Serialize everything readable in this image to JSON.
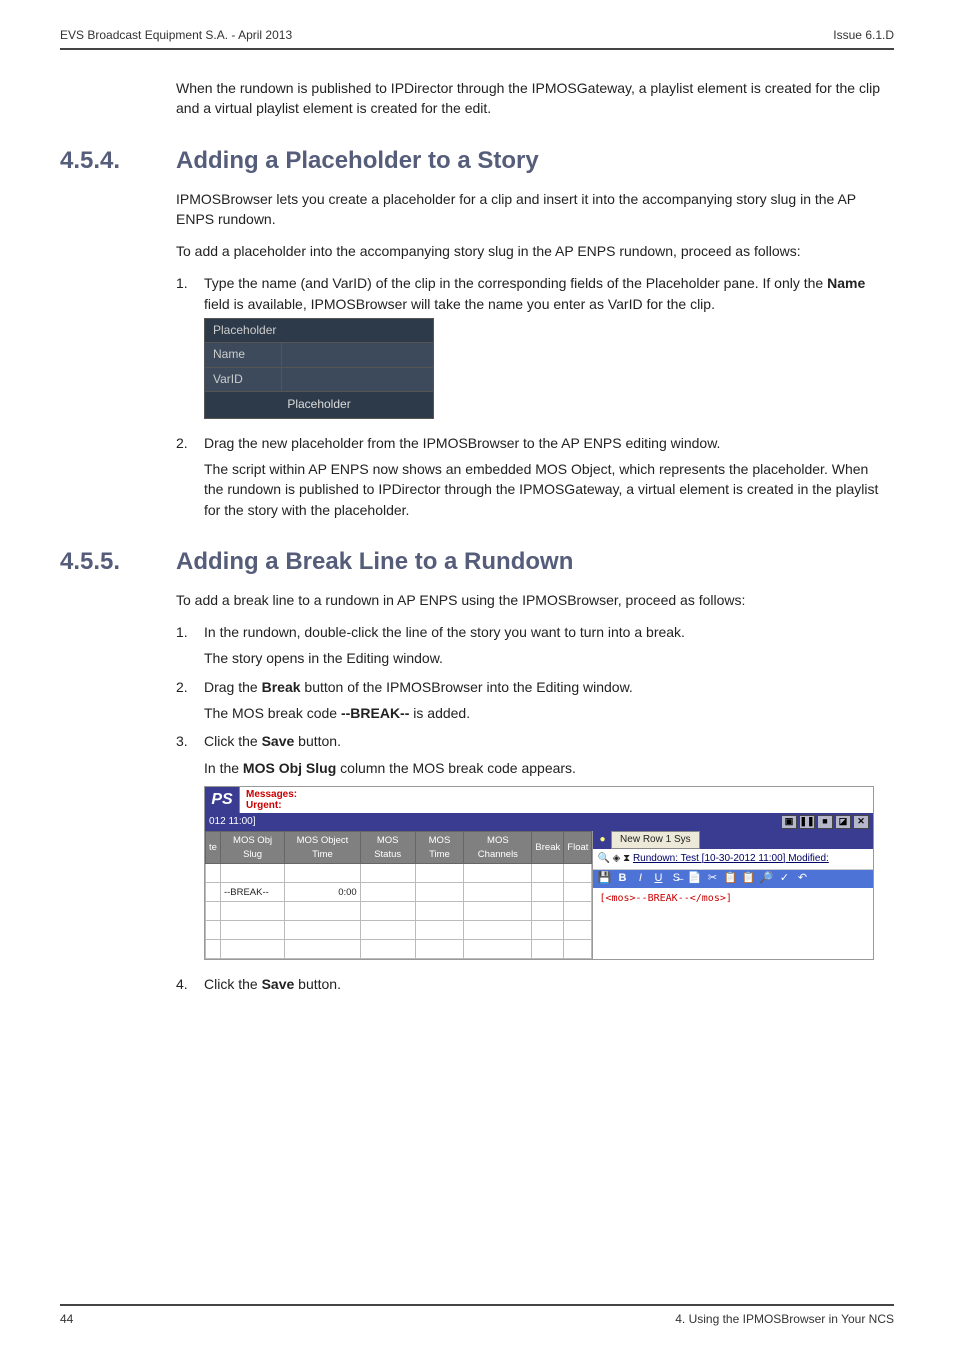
{
  "header": {
    "left": "EVS Broadcast Equipment S.A. - April 2013",
    "right": "Issue 6.1.D"
  },
  "intro": "When the rundown is published to IPDirector through the IPMOSGateway, a playlist element is created for the clip and a virtual playlist element is created for the edit.",
  "section454": {
    "num": "4.5.4.",
    "title": "Adding a Placeholder to a Story",
    "p1": "IPMOSBrowser lets you create a placeholder for a clip and insert it into the accompanying story slug in the AP ENPS rundown.",
    "p2": "To add a placeholder into the accompanying story slug in the AP ENPS rundown, proceed as follows:",
    "step1_a": "Type the name (and VarID) of the clip in the corresponding fields of the Placeholder pane. If only the ",
    "step1_b": "Name",
    "step1_c": " field is available, IPMOSBrowser will take the name you enter as VarID for the clip.",
    "ph": {
      "hdr": "Placeholder",
      "name": "Name",
      "varid": "VarID",
      "btn": "Placeholder"
    },
    "step2": "Drag the new placeholder from the IPMOSBrowser to the AP ENPS editing window.",
    "step2_p": "The script within AP ENPS now shows an embedded MOS Object, which represents the placeholder. When the rundown is published to IPDirector through the IPMOSGateway, a virtual element is created in the playlist for the story with the placeholder."
  },
  "section455": {
    "num": "4.5.5.",
    "title": "Adding a Break Line to a Rundown",
    "p1": "To add a break line to a rundown in AP ENPS using the IPMOSBrowser, proceed as follows:",
    "step1": "In the rundown, double-click the line of the story you want to turn into a break.",
    "step1_p": "The story opens in the Editing window.",
    "step2_a": "Drag the ",
    "step2_b": "Break",
    "step2_c": " button of the IPMOSBrowser into the Editing window.",
    "step2_p_a": "The MOS break code ",
    "step2_p_b": "--BREAK--",
    "step2_p_c": " is added.",
    "step3_a": "Click the ",
    "step3_b": "Save",
    "step3_c": " button.",
    "step3_p_a": "In the ",
    "step3_p_b": "MOS Obj Slug",
    "step3_p_c": " column the MOS break code appears.",
    "step4_a": "Click the ",
    "step4_b": "Save",
    "step4_c": " button."
  },
  "mos": {
    "logo": "PS",
    "msg1": "Messages:",
    "msg2": "Urgent:",
    "band": "012 11:00]",
    "cols": [
      "te",
      "MOS Obj Slug",
      "MOS Object Time",
      "MOS Status",
      "MOS Time",
      "MOS Channels",
      "Break",
      "Float"
    ],
    "row": {
      "slug": "--BREAK--",
      "time": "0:00"
    },
    "right": {
      "new": "New Row 1 Sys",
      "line": "Rundown: Test [10-30-2012 11:00]   Modified:",
      "story": "[<mos>--BREAK--</mos>]"
    }
  },
  "footer": {
    "left": "44",
    "right": "4. Using the IPMOSBrowser in Your NCS"
  }
}
